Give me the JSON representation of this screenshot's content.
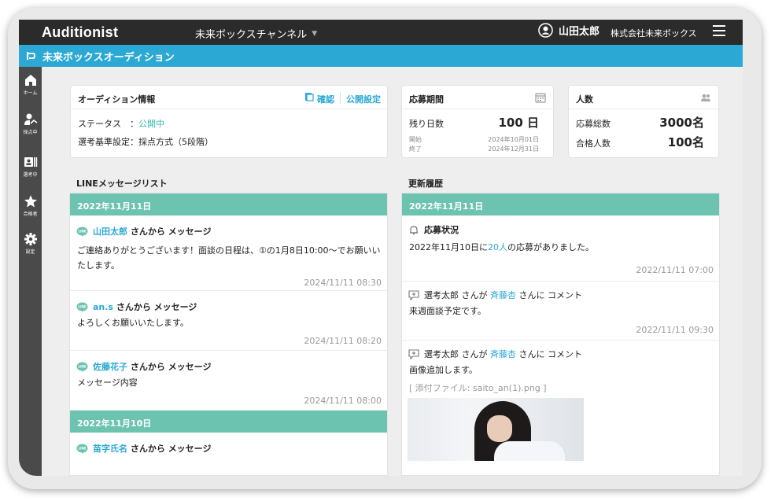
{
  "topbar": {
    "brand": "Auditionist",
    "channel": "未来ボックスチャンネル",
    "user_name": "山田太郎",
    "company": "株式会社未来ボックス"
  },
  "subbar": {
    "title": "未来ボックスオーディション"
  },
  "sidebar": {
    "items": [
      {
        "label": "ホーム",
        "icon": "home-icon"
      },
      {
        "label": "採点中",
        "icon": "scoring-icon"
      },
      {
        "label": "選考中",
        "icon": "selection-icon"
      },
      {
        "label": "合格者",
        "icon": "star-icon"
      },
      {
        "label": "設定",
        "icon": "gear-icon"
      }
    ]
  },
  "audition_info": {
    "title": "オーディション情報",
    "confirm": "確認",
    "publish_settings": "公開設定",
    "status_label": "ステータス　：",
    "status_value": "公開中",
    "criteria": "選考基準設定：採点方式（5段階）"
  },
  "period": {
    "title": "応募期間",
    "remaining_label": "残り日数",
    "remaining_value": "100 日",
    "start_label": "開始",
    "start_value": "2024年10月01日",
    "end_label": "終了",
    "end_value": "2024年12月31日"
  },
  "counts": {
    "title": "人数",
    "total_label": "応募総数",
    "total_value": "3000名",
    "passed_label": "合格人数",
    "passed_value": "100名"
  },
  "line_list": {
    "title": "LINEメッセージリスト",
    "date1": "2022年11月11日",
    "date2": "2022年11月10日",
    "from_suffix": "さんから メッセージ",
    "messages": [
      {
        "sender": "山田太郎",
        "body": "ご連絡ありがとうございます！面談の日程は、①の1月8日10:00〜でお願いいたします。",
        "time": "2024/11/11 08:30"
      },
      {
        "sender": "an.s",
        "body": "よろしくお願いいたします。",
        "time": "2024/11/11 08:20"
      },
      {
        "sender": "佐藤花子",
        "body": "メッセージ内容",
        "time": "2024/11/11 08:00"
      },
      {
        "sender": "苗字氏名"
      }
    ]
  },
  "history": {
    "title": "更新履歴",
    "date1": "2022年11月11日",
    "status": {
      "heading": "応募状況",
      "text_before": "2022年11月10日に",
      "count": "20人",
      "text_after": "の応募がありました。",
      "time": "2022/11/11 07:00"
    },
    "comments": [
      {
        "actor": "選考太郎",
        "mid": "さんが",
        "target": "斉藤杏",
        "suffix": "さんに コメント",
        "body": "来週面談予定です。",
        "time": "2022/11/11 09:30"
      },
      {
        "actor": "選考太郎",
        "mid": "さんが",
        "target": "斉藤杏",
        "suffix": "さんに コメント",
        "body": "画像追加します。",
        "attachment": "[ 添付ファイル: saito_an(1).png ]"
      }
    ]
  },
  "colors": {
    "accent": "#2ba8d4",
    "band": "#6cc3b0",
    "topbar": "#2b2b2b",
    "sidebar": "#4a4a4a",
    "teal": "#3ab8ad"
  }
}
